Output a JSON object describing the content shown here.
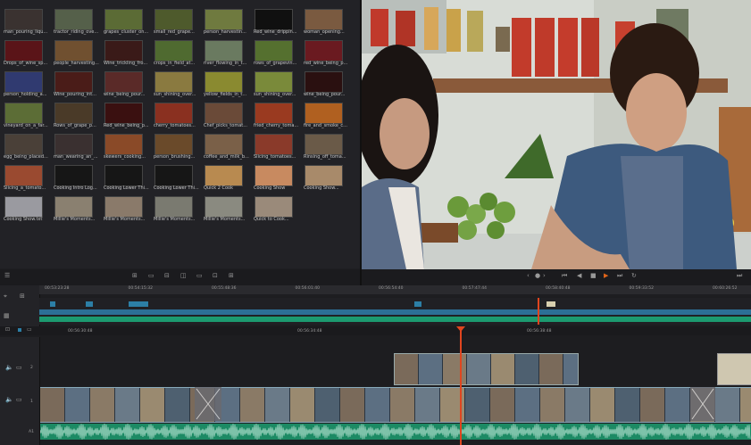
{
  "media_pool": {
    "clips": [
      {
        "label": "man_pouring_liqu...",
        "color": "#3a3230"
      },
      {
        "label": "tractor_riding_ove...",
        "color": "#55604a"
      },
      {
        "label": "grapes_cluster_on...",
        "color": "#5b6b35"
      },
      {
        "label": "small_red_grape...",
        "color": "#4e5a2c"
      },
      {
        "label": "person_harvestin...",
        "color": "#6f7a3f"
      },
      {
        "label": "Red_wine_drippin...",
        "color": "#101010"
      },
      {
        "label": "woman_opening...",
        "color": "#7a5a40"
      },
      {
        "label": "Drops_of_wine_sp...",
        "color": "#5a1418"
      },
      {
        "label": "people_harvesting...",
        "color": "#705030"
      },
      {
        "label": "Wine_trickling_fro...",
        "color": "#3a1a18"
      },
      {
        "label": "crops_in_field_at...",
        "color": "#4f6a30"
      },
      {
        "label": "river_flowing_in_t...",
        "color": "#6a7a60"
      },
      {
        "label": "rows_of_grapevin...",
        "color": "#55702f"
      },
      {
        "label": "red_wine_being_p...",
        "color": "#6a1a20"
      },
      {
        "label": "person_holding_a...",
        "color": "#303a70"
      },
      {
        "label": "Wine_pouring_int...",
        "color": "#4a1c18"
      },
      {
        "label": "wine_being_pour...",
        "color": "#5a2a28"
      },
      {
        "label": "sun_shining_over...",
        "color": "#8a7a40"
      },
      {
        "label": "yellow_fields_in_t...",
        "color": "#8a8a30"
      },
      {
        "label": "sun_shining_over...",
        "color": "#7a8a3a"
      },
      {
        "label": "wine_being_pour...",
        "color": "#2a1010"
      },
      {
        "label": "vineyard_on_a_far...",
        "color": "#5c6d36"
      },
      {
        "label": "Rows_of_grape_p...",
        "color": "#4a3a28"
      },
      {
        "label": "Red_wine_being_p...",
        "color": "#3a1010"
      },
      {
        "label": "cherry_tomatoes...",
        "color": "#8a3020"
      },
      {
        "label": "Chef_picks_tomat...",
        "color": "#6a4a38"
      },
      {
        "label": "fried_cherry_toma...",
        "color": "#9a3a20"
      },
      {
        "label": "fire_and_smoke_c...",
        "color": "#b06020"
      },
      {
        "label": "egg_being_placed...",
        "color": "#4a4038"
      },
      {
        "label": "man_wearing_an_...",
        "color": "#3a3030"
      },
      {
        "label": "skewers_cooking...",
        "color": "#8a4a28"
      },
      {
        "label": "person_brushing...",
        "color": "#6a4a2a"
      },
      {
        "label": "coffee_and_milk_b...",
        "color": "#7a6048"
      },
      {
        "label": "Slicing_tomatoes...",
        "color": "#8a3a2a"
      },
      {
        "label": "Rinsing_off_toma...",
        "color": "#6a5a48"
      },
      {
        "label": "Slicing_a_tomato...",
        "color": "#9a4a30"
      },
      {
        "label": "Cooking Intro Log...",
        "color": "#161616"
      },
      {
        "label": "Cooking Lower Thi...",
        "color": "#161616"
      },
      {
        "label": "Cooking Lower Thi...",
        "color": "#161616"
      },
      {
        "label": "Quick 2 Cook",
        "color": "#b88a50"
      },
      {
        "label": "Cooking Show",
        "color": "#c88a60"
      },
      {
        "label": "Cooking Show...",
        "color": "#a88a6a"
      },
      {
        "label": "Cooking Show.txt",
        "color": "#9a9aa0"
      },
      {
        "label": "Millie's Moments...",
        "color": "#8a8070"
      },
      {
        "label": "Millie's Moments...",
        "color": "#8a7a6a"
      },
      {
        "label": "Millie's Moments...",
        "color": "#7a7a70"
      },
      {
        "label": "Millie's Moments...",
        "color": "#8a8a80"
      },
      {
        "label": "Quick to Cook...",
        "color": "#9a8a7a"
      }
    ]
  },
  "timeline": {
    "ruler_top": [
      "00:53:23:28",
      "00:54:15:32",
      "00:55:48:36",
      "00:56:01:40",
      "00:56:54:40",
      "00:57:47:44",
      "00:58:40:48",
      "00:59:33:52",
      "00:60:26:52"
    ],
    "ruler_bottom": [
      "00:56:30:48",
      "00:56:34:48",
      "00:56:38:48"
    ],
    "tracks": [
      {
        "name": "V2",
        "label": "2"
      },
      {
        "name": "V1",
        "label": "1"
      },
      {
        "name": "A1",
        "label": "A1"
      }
    ]
  },
  "colors": {
    "accent_orange": "#e0651a",
    "audio_green": "#1c9a70",
    "clip_blue": "#2c7fa6",
    "playhead": "#e0451f"
  }
}
